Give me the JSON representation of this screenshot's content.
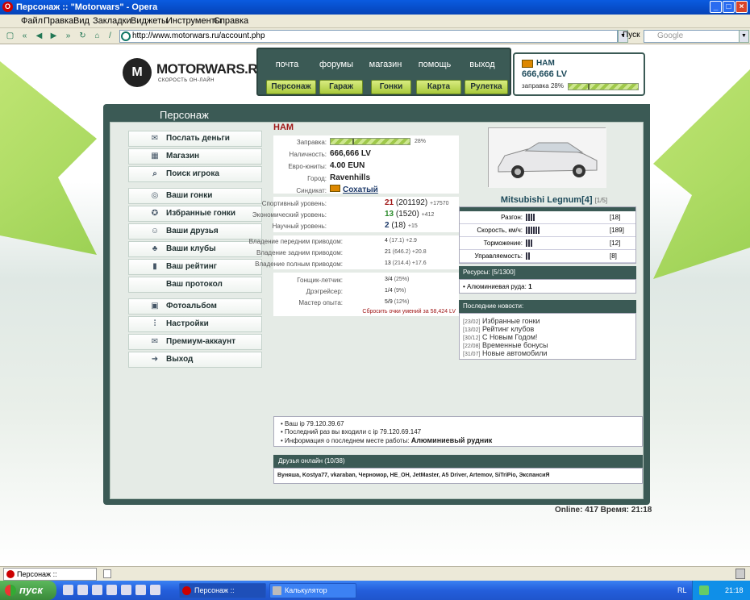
{
  "window": {
    "title": "Персонаж :: \"Motorwars\" - Opera"
  },
  "menu": [
    "Файл",
    "Правка",
    "Вид",
    "Закладки",
    "Виджеты",
    "Инструменты",
    "Справка"
  ],
  "address": {
    "url": "http://www.motorwars.ru/account.php",
    "search_label": "Пуск",
    "search_placeholder": "Google"
  },
  "site": {
    "logo": "MOTORWARS.RU",
    "tagline": "СКОРОСТЬ ОН-ЛАЙН",
    "top_links": [
      "почта",
      "форумы",
      "магазин",
      "помощь",
      "выход"
    ],
    "top_buttons": [
      "Персонаж",
      "Гараж",
      "Гонки",
      "Карта",
      "Рулетка"
    ]
  },
  "userbox": {
    "name": "НАМ",
    "money": "666,666 LV",
    "fuel_label": "заправка 28%",
    "fuel": 0.28
  },
  "panel": {
    "title": "Персонаж"
  },
  "nav": [
    {
      "label": "Послать деньги",
      "icon": "money-icon"
    },
    {
      "label": "Магазин",
      "icon": "cart-icon"
    },
    {
      "label": "Поиск игрока",
      "icon": "search-icon"
    },
    {
      "label": "Ваши гонки",
      "icon": "steering-icon"
    },
    {
      "label": "Избранные гонки",
      "icon": "star-steering-icon"
    },
    {
      "label": "Ваши друзья",
      "icon": "friends-icon"
    },
    {
      "label": "Ваши клубы",
      "icon": "clubs-icon"
    },
    {
      "label": "Ваш рейтинг",
      "icon": "rating-icon"
    },
    {
      "label": "Ваш протокол",
      "icon": ""
    },
    {
      "label": "Фотоальбом",
      "icon": "camera-icon"
    },
    {
      "label": "Настройки",
      "icon": "settings-icon"
    },
    {
      "label": "Премиум-аккаунт",
      "icon": "premium-icon"
    },
    {
      "label": "Выход",
      "icon": "exit-icon"
    }
  ],
  "profile": {
    "name": "НАМ",
    "fuel_label": "Заправка:",
    "fuel_pct": "28%",
    "fuel": 0.28,
    "cash_label": "Наличность:",
    "cash": "666,666 LV",
    "euro_label": "Евро-юниты:",
    "euro": "4.00 EUN",
    "city_label": "Город:",
    "city": "Ravenhills",
    "syndicate_label": "Синдикат:",
    "syndicate": "Сохатый",
    "sport_label": "Спортивный уровень:",
    "sport_level": "21",
    "sport_pts": "(201192)",
    "sport_next": "+17570",
    "eco_label": "Экономический уровень:",
    "eco_level": "13",
    "eco_pts": "(1520)",
    "eco_next": "+412",
    "sci_label": "Научный уровень:",
    "sci_level": "2",
    "sci_pts": "(18)",
    "sci_next": "+15",
    "fwd_label": "Владение передним приводом:",
    "fwd": "4",
    "fwd_pts": "(17.1)",
    "fwd_next": "+2.9",
    "rwd_label": "Владение задним приводом:",
    "rwd": "21",
    "rwd_pts": "(646.2)",
    "rwd_next": "+20.8",
    "awd_label": "Владение полным приводом:",
    "awd": "13",
    "awd_pts": "(214.4)",
    "awd_next": "+17.6",
    "racer_label": "Гонщик-летчик:",
    "racer": "3/4",
    "racer_pct": "(25%)",
    "drag_label": "Дрэгрейсер:",
    "drag": "1/4",
    "drag_pct": "(9%)",
    "master_label": "Мастер опыта:",
    "master": "5/9",
    "master_pct": "(12%)",
    "reset_link": "Сбросить очки умений за 58,424 LV"
  },
  "car": {
    "name": "Mitsubishi Legnum[4]",
    "slot": "[1/5]",
    "stats": [
      {
        "label": "Разгон:",
        "bars": 4,
        "value": "[18]"
      },
      {
        "label": "Скорость, км/ч:",
        "bars": 6,
        "value": "[189]"
      },
      {
        "label": "Торможение:",
        "bars": 3,
        "value": "[12]"
      },
      {
        "label": "Управляемость:",
        "bars": 2,
        "value": "[8]"
      }
    ]
  },
  "resources": {
    "header": "Ресурсы: [5/1300]",
    "item": "Алюминиевая руда:",
    "count": "1"
  },
  "news": {
    "header": "Последние новости:",
    "items": [
      {
        "date": "[23/02]",
        "text": "Избранные гонки"
      },
      {
        "date": "[13/02]",
        "text": "Рейтинг клубов"
      },
      {
        "date": "[30/12]",
        "text": "С Новым Годом!"
      },
      {
        "date": "[22/08]",
        "text": "Временные бонусы"
      },
      {
        "date": "[31/07]",
        "text": "Новые автомобили"
      }
    ]
  },
  "info": {
    "ip": "Ваш ip 79.120.39.67",
    "last": "Последний раз вы входили с ip 79.120.69.147",
    "work_label": "Информация о последнем месте работы:",
    "work": "Алюминиевый рудник"
  },
  "friends": {
    "header": "Друзья онлайн (10/38)",
    "list": "Вуняша, Kostya77, vkaraban, Черномор, HE_OH, JetMaster, A5 Driver, Artemov, SiTriPio, ЭкспансиЯ"
  },
  "footer": {
    "online": "Online: 417  Время: 21:18"
  },
  "tabstrip": {
    "tab": "Персонаж :: \"Motorwars\""
  },
  "taskbar": {
    "start": "пуск",
    "tasks": [
      "Персонаж :: \"Motorwa...",
      "Калькулятор"
    ],
    "lang": "RL",
    "clock": "21:18"
  }
}
